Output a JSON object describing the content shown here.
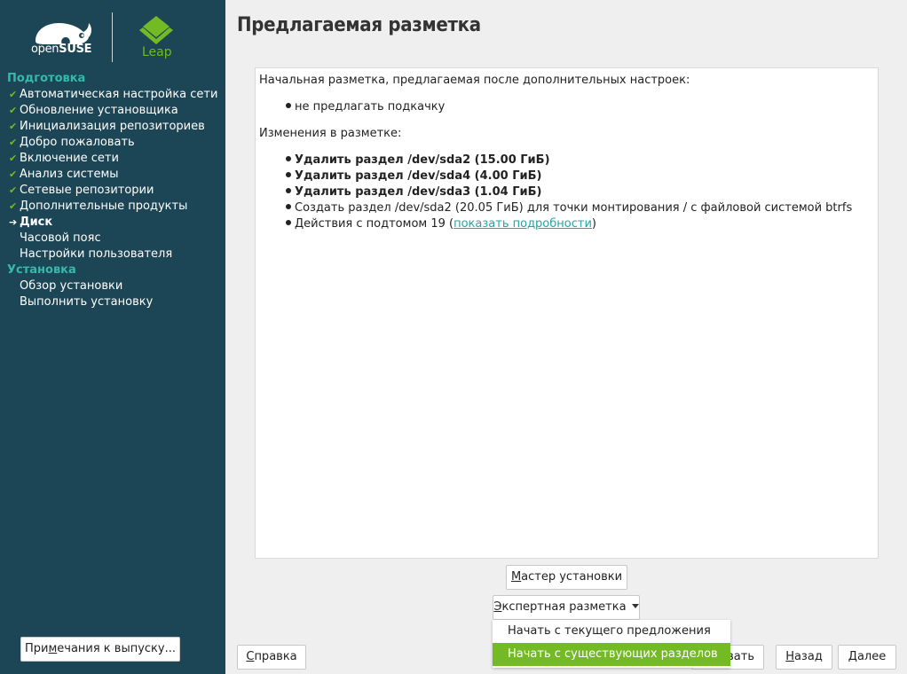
{
  "sidebar": {
    "logo_open": "open",
    "logo_suse": "SUSE",
    "logo_leap": "Leap",
    "sections": [
      {
        "title": "Подготовка",
        "items": [
          {
            "label": "Автоматическая настройка сети",
            "state": "done"
          },
          {
            "label": "Обновление установщика",
            "state": "done"
          },
          {
            "label": "Инициализация репозиториев",
            "state": "done"
          },
          {
            "label": "Добро пожаловать",
            "state": "done"
          },
          {
            "label": "Включение сети",
            "state": "done"
          },
          {
            "label": "Анализ системы",
            "state": "done"
          },
          {
            "label": "Сетевые репозитории",
            "state": "done"
          },
          {
            "label": "Дополнительные продукты",
            "state": "done"
          },
          {
            "label": "Диск",
            "state": "current"
          },
          {
            "label": "Часовой пояс",
            "state": "pending"
          },
          {
            "label": "Настройки пользователя",
            "state": "pending"
          }
        ]
      },
      {
        "title": "Установка",
        "items": [
          {
            "label": "Обзор установки",
            "state": "pending"
          },
          {
            "label": "Выполнить установку",
            "state": "pending"
          }
        ]
      }
    ],
    "release_notes_prefix": "При",
    "release_notes_mnemonic": "м",
    "release_notes_suffix": "ечания к выпуску..."
  },
  "main": {
    "title": "Предлагаемая разметка",
    "initial_heading": "Начальная разметка, предлагаемая после дополнительных настроек:",
    "initial_items": [
      "не предлагать подкачку"
    ],
    "changes_heading": "Изменения в разметке:",
    "changes_items": [
      "Удалить раздел /dev/sda2 (15.00 ГиБ)",
      "Удалить раздел /dev/sda4 (4.00 ГиБ)",
      "Удалить раздел /dev/sda3 (1.04 ГиБ)",
      "Создать раздел /dev/sda2 (20.05 ГиБ) для точки монтирования / с файловой системой btrfs"
    ],
    "actions_prefix": "Действия с подтомом 19 (",
    "actions_link": "показать подробности",
    "actions_suffix": ")",
    "guided_setup_mnemonic": "М",
    "guided_setup_rest": "астер установки",
    "expert_mnemonic": "Э",
    "expert_rest": "кспертная разметка",
    "expert_menu": [
      {
        "label": "Начать с текущего предложения",
        "selected": false
      },
      {
        "label": "Начать с существующих разделов",
        "selected": true
      }
    ]
  },
  "footer": {
    "help_mnemonic": "С",
    "help_rest": "правка",
    "abort_partial": "вать",
    "back_mnemonic": "Н",
    "back_rest": "азад",
    "next_mnemonic": "Д",
    "next_rest": "алее"
  },
  "colors": {
    "sidebar_bg": "#1c4555",
    "section_title": "#35b9ab",
    "check_green": "#73ba25",
    "link": "#21a7a2",
    "menu_selected": "#73ba25"
  }
}
